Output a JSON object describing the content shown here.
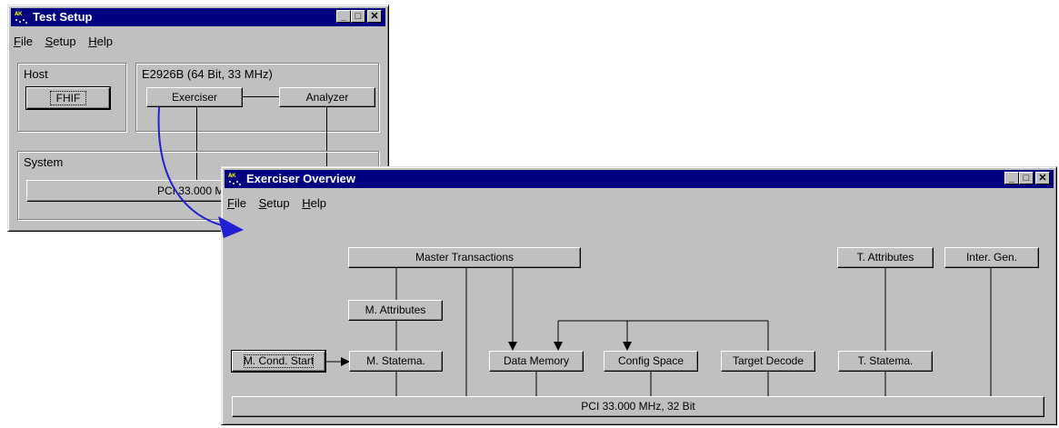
{
  "test_setup": {
    "title": "Test Setup",
    "menu": [
      {
        "label": "File",
        "ul": "F",
        "rest": "ile"
      },
      {
        "label": "Setup",
        "ul": "S",
        "rest": "etup"
      },
      {
        "label": "Help",
        "ul": "H",
        "rest": "elp"
      }
    ],
    "host_label": "Host",
    "host_button": "FHIF",
    "device_label": "E2926B (64 Bit, 33 MHz)",
    "exerciser_button": "Exerciser",
    "analyzer_button": "Analyzer",
    "system_label": "System",
    "pci_button": "PCI 33.000 MHz"
  },
  "exerciser_overview": {
    "title": "Exerciser Overview",
    "menu": [
      {
        "label": "File",
        "ul": "F",
        "rest": "ile"
      },
      {
        "label": "Setup",
        "ul": "S",
        "rest": "etup"
      },
      {
        "label": "Help",
        "ul": "H",
        "rest": "elp"
      }
    ],
    "master_transactions": "Master Transactions",
    "t_attributes": "T. Attributes",
    "inter_gen": "Inter. Gen.",
    "m_attributes": "M. Attributes",
    "m_cond_start": "M. Cond. Start",
    "m_statema": "M. Statema.",
    "data_memory": "Data Memory",
    "config_space": "Config Space",
    "target_decode": "Target Decode",
    "t_statema": "T. Statema.",
    "pci_bus": "PCI 33.000 MHz, 32 Bit"
  },
  "colors": {
    "titlebar": "#000080",
    "window_face": "#c0c0c0",
    "arrow": "#2020d0"
  },
  "icons": [
    "app-icon",
    "minimize-icon",
    "maximize-icon",
    "close-icon"
  ]
}
